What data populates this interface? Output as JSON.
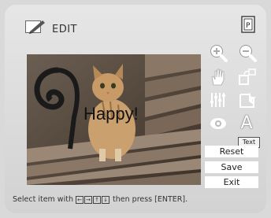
{
  "header": {
    "title": "EDIT"
  },
  "photo": {
    "overlay_text": "Happy!"
  },
  "tools": {
    "text_letter": "A",
    "tooltip": "Text"
  },
  "buttons": {
    "reset": "Reset",
    "save": "Save",
    "exit": "Exit"
  },
  "status": {
    "prefix": "Select item with",
    "suffix": "then press [ENTER].",
    "keys": [
      "←",
      "→",
      "↑",
      "↓"
    ]
  },
  "colors": {
    "panel": "#dcdcdc",
    "icon_white": "#ffffff",
    "button_bg": "#ffffff"
  }
}
